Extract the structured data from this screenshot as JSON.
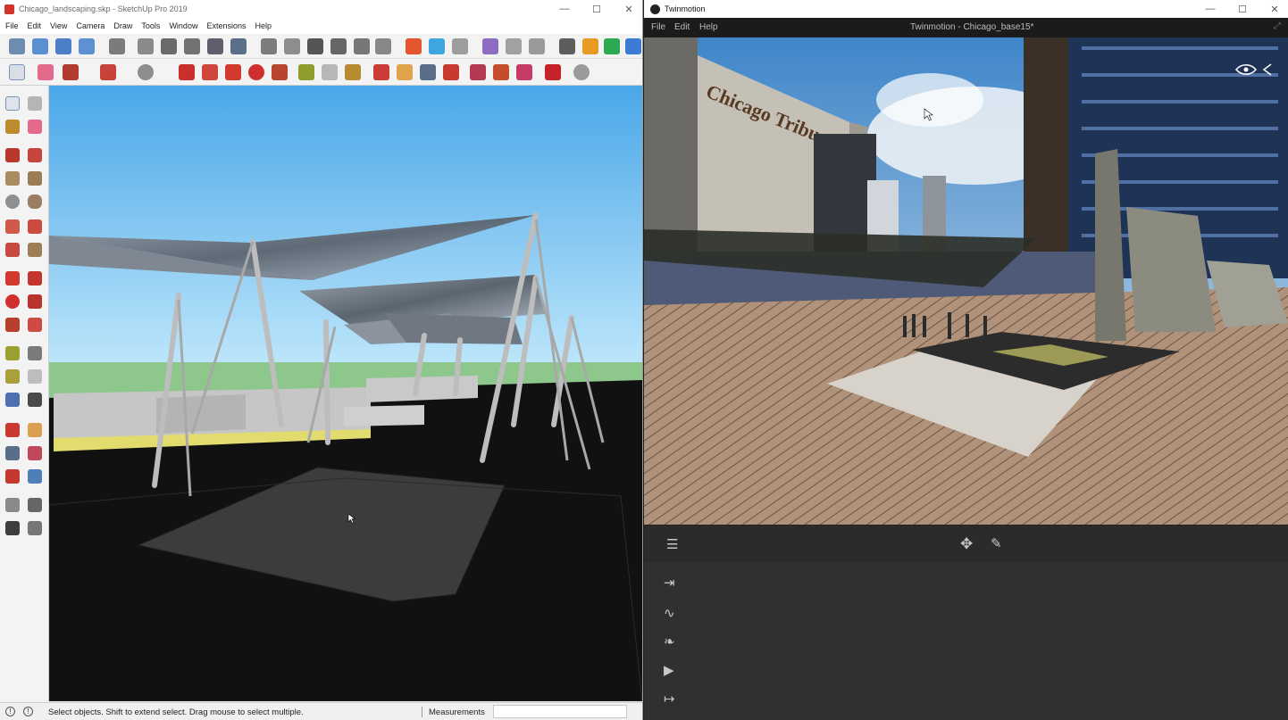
{
  "sketchup": {
    "title": "Chicago_landscaping.skp - SketchUp Pro 2019",
    "menu": [
      "File",
      "Edit",
      "View",
      "Camera",
      "Draw",
      "Tools",
      "Window",
      "Extensions",
      "Help"
    ],
    "status_text": "Select objects. Shift to extend select. Drag mouse to select multiple.",
    "measurements_label": "Measurements",
    "measurements_value": "",
    "info_glyph": "!"
  },
  "twinmotion": {
    "title": "Twinmotion",
    "menu": [
      "File",
      "Edit",
      "Help"
    ],
    "document": "Twinmotion - Chicago_base15*",
    "building_sign": "Chicago Tribune"
  },
  "window_controls": {
    "minimize": "—",
    "maximize": "☐",
    "close": "✕"
  },
  "colors": {
    "sky_top": "#4aa7e8",
    "sky_bottom": "#bfe7fb",
    "grass": "#8dc78c",
    "ground": "#111111",
    "tm_panel": "#303030"
  },
  "icons": {
    "menu": "hamburger-icon",
    "move": "move-arrows-icon",
    "pick": "eyedropper-icon",
    "import": "import-icon",
    "context": "landscape-icon",
    "settings": "leaf-icon",
    "media": "media-play-icon",
    "export": "export-icon",
    "visibility": "eye-icon"
  }
}
